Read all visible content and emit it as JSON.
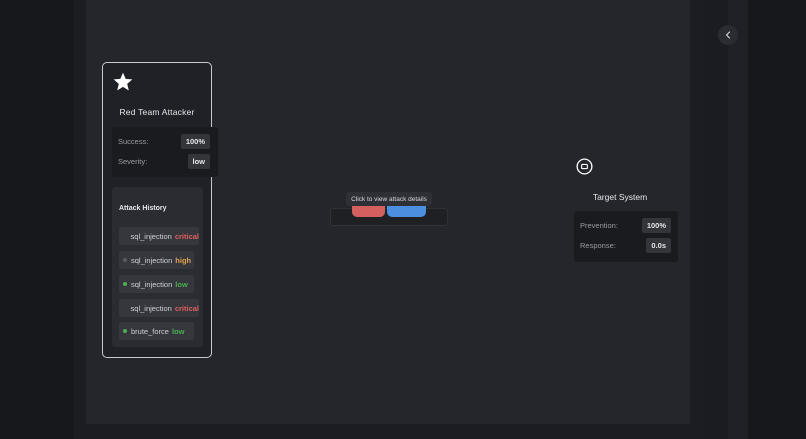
{
  "attacker": {
    "icon": "star-icon",
    "title": "Red Team Attacker",
    "stats": [
      {
        "label": "Success:",
        "value": "100%"
      },
      {
        "label": "Severity:",
        "value": "low"
      }
    ],
    "history_title": "Attack History",
    "history": [
      {
        "type": "sql_injection",
        "severity": "critical",
        "severity_color": "#e06060",
        "dot": false
      },
      {
        "type": "sql_injection",
        "severity": "high",
        "severity_color": "#e0a050",
        "dot": true,
        "dot_color": "#555960"
      },
      {
        "type": "sql_injection",
        "severity": "low",
        "severity_color": "#4caf50",
        "dot": true,
        "dot_color": "#4caf50"
      },
      {
        "type": "sql_injection",
        "severity": "critical",
        "severity_color": "#e06060",
        "dot": false
      },
      {
        "type": "brute_force",
        "severity": "low",
        "severity_color": "#4caf50",
        "dot": true,
        "dot_color": "#4caf50"
      }
    ]
  },
  "target": {
    "icon": "target-square-icon",
    "title": "Target System",
    "stats": [
      {
        "label": "Prevention:",
        "value": "100%"
      },
      {
        "label": "Response:",
        "value": "0.0s"
      }
    ]
  },
  "edge": {
    "tooltip": "Click to view attack details"
  },
  "sidebar": {
    "collapse_icon": "chevron-left-icon"
  }
}
